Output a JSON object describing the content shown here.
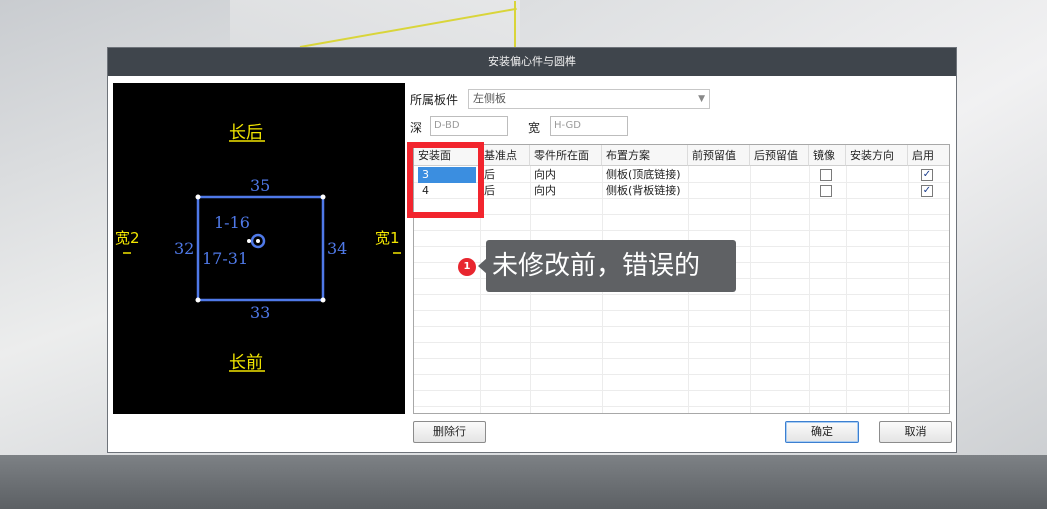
{
  "dialog": {
    "title": "安装偏心件与圆榫",
    "board_label": "所属板件",
    "board_value": "左侧板",
    "depth_label": "深",
    "depth_placeholder": "D-BD",
    "width_label": "宽",
    "width_placeholder": "H-GD"
  },
  "preview": {
    "top_label": "长后",
    "bottom_label": "长前",
    "left_label": "宽2",
    "right_label": "宽1",
    "edge_top": "35",
    "edge_bottom": "33",
    "edge_left": "32",
    "edge_right": "34",
    "inner_1": "1-16",
    "inner_2": "17-31"
  },
  "table": {
    "columns": [
      "安装面",
      "基准点",
      "零件所在面",
      "布置方案",
      "前预留值",
      "后预留值",
      "镜像",
      "安装方向",
      "启用"
    ],
    "rows": [
      {
        "face": "3",
        "base": "后",
        "part_face": "向内",
        "scheme": "侧板(顶底链接)",
        "front": "",
        "back": "",
        "mirror": false,
        "direction": "",
        "enabled": true
      },
      {
        "face": "4",
        "base": "后",
        "part_face": "向内",
        "scheme": "侧板(背板链接)",
        "front": "",
        "back": "",
        "mirror": false,
        "direction": "",
        "enabled": true
      }
    ]
  },
  "buttons": {
    "delete_row": "删除行",
    "ok": "确定",
    "cancel": "取消"
  },
  "annotation": {
    "badge": "1",
    "text": "未修改前，错误的"
  },
  "colors": {
    "title_bar": "#3f454c",
    "preview_bg": "#000000",
    "preview_yellow": "#f2e600",
    "preview_blue": "#4f79e8",
    "selection": "#3b8ee0",
    "highlight": "#f2252e",
    "tooltip": "#5f6164"
  },
  "icons": {
    "dropdown": "chevron-down-icon",
    "checkbox": "check-icon"
  }
}
